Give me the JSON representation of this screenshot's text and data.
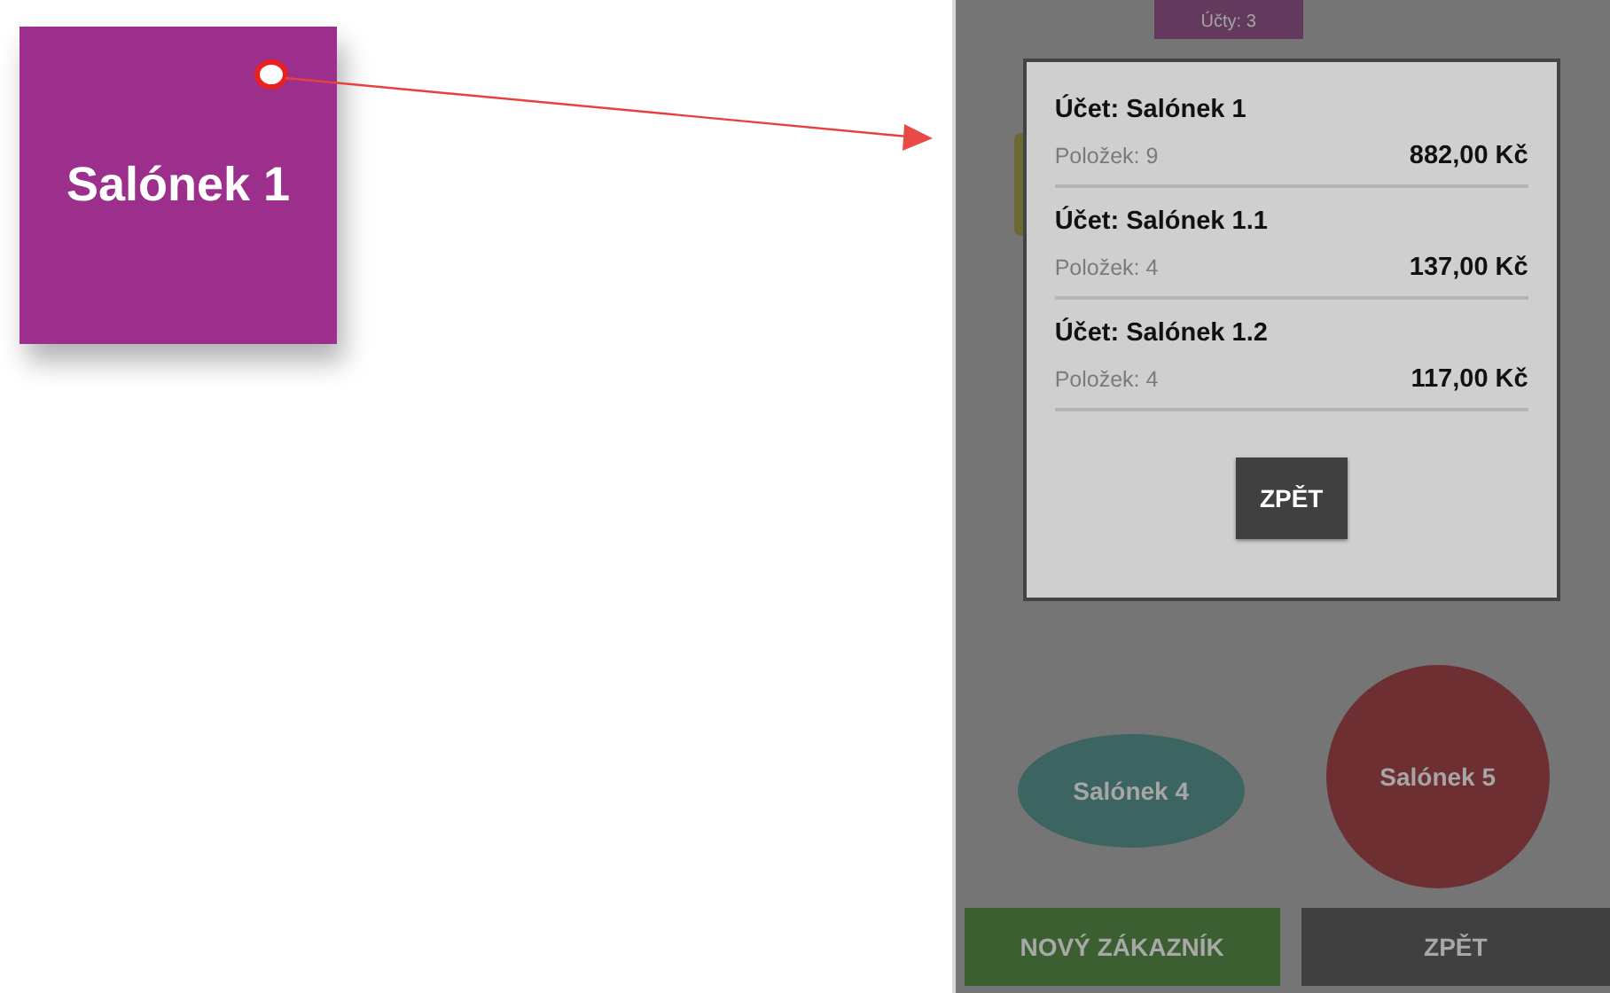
{
  "preview_tile": {
    "label": "Salónek 1",
    "color": "#9c2f8c"
  },
  "floor_plan": {
    "tables": [
      {
        "kind": "rect",
        "label": "Účty: 3",
        "color": "#633a5e"
      },
      {
        "kind": "rect",
        "color": "#6b6830"
      },
      {
        "kind": "ellipse",
        "label": "Salónek 4",
        "color": "#3c6561"
      },
      {
        "kind": "circle",
        "label": "Salónek 5",
        "color": "#6e2f33"
      }
    ]
  },
  "dialog": {
    "accounts": [
      {
        "title": "Účet: Salónek 1",
        "items_label": "Položek: 9",
        "total": "882,00 Kč"
      },
      {
        "title": "Účet: Salónek 1.1",
        "items_label": "Položek: 4",
        "total": "137,00 Kč"
      },
      {
        "title": "Účet: Salónek 1.2",
        "items_label": "Položek: 4",
        "total": "117,00 Kč"
      }
    ],
    "button": "ZPĚT"
  },
  "bottom_buttons": [
    {
      "label": "NOVÝ ZÁKAZNÍK",
      "kind": "primary"
    },
    {
      "label": "ZPĚT",
      "kind": "secondary"
    }
  ]
}
